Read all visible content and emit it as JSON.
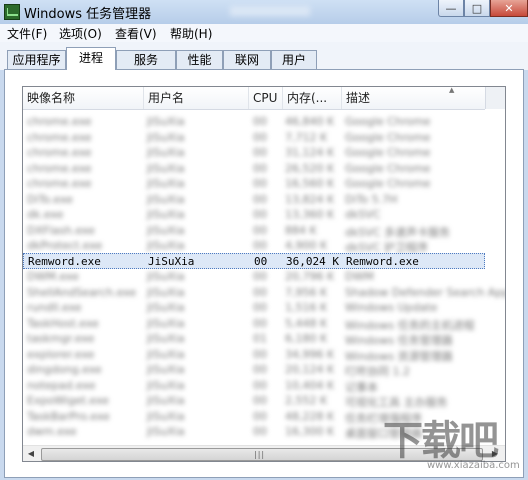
{
  "window": {
    "title": "Windows 任务管理器",
    "buttons": {
      "minimize": "—",
      "maximize": "□",
      "close": "✕"
    }
  },
  "menu": [
    "文件(F)",
    "选项(O)",
    "查看(V)",
    "帮助(H)"
  ],
  "tabs": [
    "应用程序",
    "进程",
    "服务",
    "性能",
    "联网",
    "用户"
  ],
  "active_tab": "进程",
  "columns": [
    "映像名称",
    "用户名",
    "CPU",
    "内存(...",
    "描述"
  ],
  "rows": [
    {
      "name": "chrome.exe",
      "user": "JiSuXia",
      "cpu": "00",
      "mem": "46,840 K",
      "desc": "Google Chrome",
      "blurred": true
    },
    {
      "name": "chrome.exe",
      "user": "JiSuXia",
      "cpu": "00",
      "mem": "7,712 K",
      "desc": "Google Chrome",
      "blurred": true
    },
    {
      "name": "chrome.exe",
      "user": "JiSuXia",
      "cpu": "00",
      "mem": "31,124 K",
      "desc": "Google Chrome",
      "blurred": true
    },
    {
      "name": "chrome.exe",
      "user": "JiSuXia",
      "cpu": "00",
      "mem": "26,520 K",
      "desc": "Google Chrome",
      "blurred": true
    },
    {
      "name": "chrome.exe",
      "user": "JiSuXia",
      "cpu": "00",
      "mem": "16,560 K",
      "desc": "Google Chrome",
      "blurred": true
    },
    {
      "name": "DiTo.exe",
      "user": "JiSuXia",
      "cpu": "00",
      "mem": "13,824 K",
      "desc": "DiTo 5.7H",
      "blurred": true
    },
    {
      "name": "dk.exe",
      "user": "JiSuXia",
      "cpu": "00",
      "mem": "13,360 K",
      "desc": "dkSVC",
      "blurred": true
    },
    {
      "name": "DXFlash.exe",
      "user": "JiSuXia",
      "cpu": "00",
      "mem": "884 K",
      "desc": "dkSVC 多速声卡服务",
      "blurred": true
    },
    {
      "name": "dkProtect.exe",
      "user": "JiSuXia",
      "cpu": "00",
      "mem": "4,900 K",
      "desc": "dkSVC 护卫程序",
      "blurred": true
    },
    {
      "name": "Remword.exe",
      "user": "JiSuXia",
      "cpu": "00",
      "mem": "36,024 K",
      "desc": "Remword.exe",
      "blurred": false,
      "selected": true
    },
    {
      "name": "DWM.exe",
      "user": "JiSuXia",
      "cpu": "00",
      "mem": "20,796 K",
      "desc": "DWM",
      "blurred": true
    },
    {
      "name": "ShellAndSearch.exe",
      "user": "JiSuXia",
      "cpu": "00",
      "mem": "7,956 K",
      "desc": "Shadow Defender Search App",
      "blurred": true
    },
    {
      "name": "rundll.exe",
      "user": "JiSuXia",
      "cpu": "00",
      "mem": "1,516 K",
      "desc": "Windows Update",
      "blurred": true
    },
    {
      "name": "TaskHost.exe",
      "user": "JiSuXia",
      "cpu": "00",
      "mem": "5,448 K",
      "desc": "Windows 任务的主机进程",
      "blurred": true
    },
    {
      "name": "taskmgr.exe",
      "user": "JiSuXia",
      "cpu": "01",
      "mem": "6,180 K",
      "desc": "Windows 任务管理器",
      "blurred": true
    },
    {
      "name": "explorer.exe",
      "user": "JiSuXia",
      "cpu": "00",
      "mem": "34,996 K",
      "desc": "Windows 资源管理器",
      "blurred": true
    },
    {
      "name": "dingdong.exe",
      "user": "JiSuXia",
      "cpu": "00",
      "mem": "20,124 K",
      "desc": "叮咚协同 1.2",
      "blurred": true
    },
    {
      "name": "notepad.exe",
      "user": "JiSuXia",
      "cpu": "00",
      "mem": "10,404 K",
      "desc": "记事本",
      "blurred": true
    },
    {
      "name": "ExpoWiget.exe",
      "user": "JiSuXia",
      "cpu": "00",
      "mem": "2,552 K",
      "desc": "可视化工具 主办服务",
      "blurred": true
    },
    {
      "name": "TaskBarPro.exe",
      "user": "JiSuXia",
      "cpu": "00",
      "mem": "48,228 K",
      "desc": "任务栏增强程序",
      "blurred": true
    },
    {
      "name": "dwm.exe",
      "user": "JiSuXia",
      "cpu": "00",
      "mem": "16,300 K",
      "desc": "桌面窗口管理器",
      "blurred": true
    }
  ],
  "watermark": {
    "main": "下载吧",
    "sub": "www.xiazaiba.com"
  }
}
